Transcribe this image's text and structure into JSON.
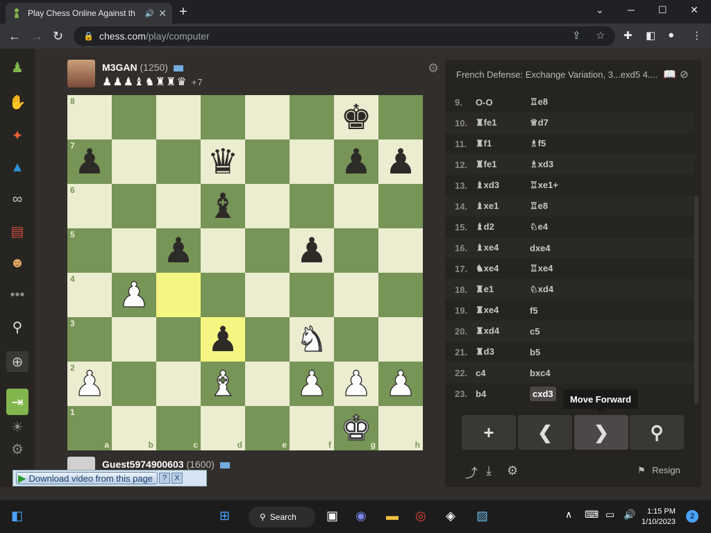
{
  "browser": {
    "tab_title": "Play Chess Online Against th",
    "url_domain": "chess.com",
    "url_path": "/play/computer",
    "tab_close": "✕",
    "new_tab": "+",
    "minimize": "─",
    "maximize": "☐",
    "close": "✕"
  },
  "opponent": {
    "name": "M3GAN",
    "rating": "(1250)",
    "captured": "♟♟♟♝♞♜♜♛",
    "material_diff": "+7"
  },
  "player": {
    "name": "Guest5974900603",
    "rating": "(1600)"
  },
  "board": {
    "rank_labels": [
      "8",
      "7",
      "6",
      "5",
      "4",
      "3",
      "2",
      "1"
    ],
    "file_labels": [
      "a",
      "b",
      "c",
      "d",
      "e",
      "f",
      "g",
      "h"
    ],
    "highlighted_squares": [
      "c4",
      "d3"
    ],
    "light_color": "#ebecd0",
    "dark_color": "#779556",
    "highlight_color": "#f5f682",
    "pieces": [
      {
        "square": "g8",
        "glyph": "♚",
        "color": "b"
      },
      {
        "square": "a7",
        "glyph": "♟",
        "color": "b"
      },
      {
        "square": "d7",
        "glyph": "♛",
        "color": "b"
      },
      {
        "square": "g7",
        "glyph": "♟",
        "color": "b"
      },
      {
        "square": "h7",
        "glyph": "♟",
        "color": "b"
      },
      {
        "square": "d6",
        "glyph": "♝",
        "color": "b"
      },
      {
        "square": "c5",
        "glyph": "♟",
        "color": "b"
      },
      {
        "square": "f5",
        "glyph": "♟",
        "color": "b"
      },
      {
        "square": "b4",
        "glyph": "♟",
        "color": "w"
      },
      {
        "square": "d3",
        "glyph": "♟",
        "color": "b"
      },
      {
        "square": "f3",
        "glyph": "♞",
        "color": "w"
      },
      {
        "square": "a2",
        "glyph": "♟",
        "color": "w"
      },
      {
        "square": "d2",
        "glyph": "♝",
        "color": "w"
      },
      {
        "square": "f2",
        "glyph": "♟",
        "color": "w"
      },
      {
        "square": "g2",
        "glyph": "♟",
        "color": "w"
      },
      {
        "square": "h2",
        "glyph": "♟",
        "color": "w"
      },
      {
        "square": "g1",
        "glyph": "♚",
        "color": "w"
      }
    ]
  },
  "download_bar": {
    "label": "Download video from this page",
    "help": "?",
    "close": "X"
  },
  "panel": {
    "opening": "French Defense: Exchange Variation, 3...exd5 4....",
    "moves": [
      {
        "num": "9.",
        "white": "O-O",
        "black": "♖e8"
      },
      {
        "num": "10.",
        "white": "♜fe1",
        "black": "♕d7"
      },
      {
        "num": "11.",
        "white": "♜f1",
        "black": "♗f5"
      },
      {
        "num": "12.",
        "white": "♜fe1",
        "black": "♗xd3"
      },
      {
        "num": "13.",
        "white": "♝xd3",
        "black": "♖xe1+"
      },
      {
        "num": "14.",
        "white": "♝xe1",
        "black": "♖e8"
      },
      {
        "num": "15.",
        "white": "♝d2",
        "black": "♘e4"
      },
      {
        "num": "16.",
        "white": "♝xe4",
        "black": "dxe4"
      },
      {
        "num": "17.",
        "white": "♞xe4",
        "black": "♖xe4"
      },
      {
        "num": "18.",
        "white": "♜e1",
        "black": "♘xd4"
      },
      {
        "num": "19.",
        "white": "♜xe4",
        "black": "f5"
      },
      {
        "num": "20.",
        "white": "♜xd4",
        "black": "c5"
      },
      {
        "num": "21.",
        "white": "♜d3",
        "black": "b5"
      },
      {
        "num": "22.",
        "white": "c4",
        "black": "bxc4"
      },
      {
        "num": "23.",
        "white": "b4",
        "black": "cxd3"
      }
    ],
    "tooltip": "Move Forward",
    "controls": [
      "+",
      "❮",
      "❯",
      "⚲"
    ],
    "resign": "Resign"
  },
  "taskbar": {
    "search": "Search",
    "time": "1:15 PM",
    "date": "1/10/2023",
    "notification_count": "2"
  }
}
